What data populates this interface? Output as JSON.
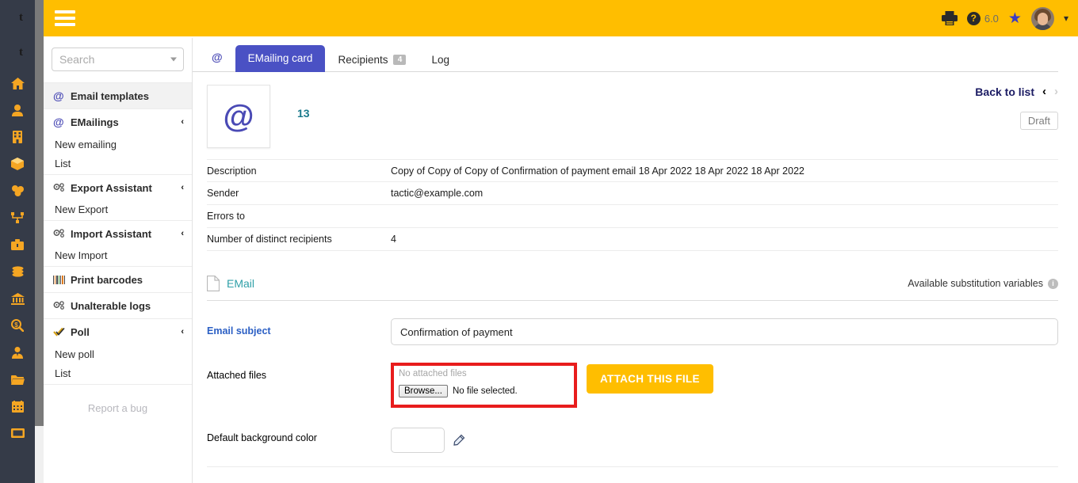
{
  "topbar": {
    "menu_icon": "hamburger-icon",
    "print_icon": "printer-icon",
    "help_icon": "help-question-icon",
    "version": "6.0",
    "star_icon": "star-icon",
    "avatar_icon": "user-avatar",
    "caret": "⌄"
  },
  "sidebar": {
    "search": {
      "value": "",
      "placeholder": "Search"
    },
    "groups": [
      {
        "icon": "at-icon",
        "label": "Email templates",
        "active": true,
        "collapsible": false,
        "chevron": "",
        "items": []
      },
      {
        "icon": "at-icon",
        "label": "EMailings",
        "active": false,
        "collapsible": true,
        "chevron": "‹",
        "items": [
          "New emailing",
          "List"
        ]
      },
      {
        "icon": "gear-icon",
        "label": "Export Assistant",
        "active": false,
        "collapsible": true,
        "chevron": "‹",
        "items": [
          "New Export"
        ]
      },
      {
        "icon": "gear-icon",
        "label": "Import Assistant",
        "active": false,
        "collapsible": true,
        "chevron": "‹",
        "items": [
          "New Import"
        ]
      },
      {
        "icon": "barcode-icon",
        "label": "Print barcodes",
        "active": false,
        "collapsible": false,
        "chevron": "",
        "items": []
      },
      {
        "icon": "gear-icon",
        "label": "Unalterable logs",
        "active": false,
        "collapsible": false,
        "chevron": "",
        "items": []
      },
      {
        "icon": "check-icon",
        "label": "Poll",
        "active": false,
        "collapsible": true,
        "chevron": "‹",
        "items": [
          "New poll",
          "List"
        ]
      }
    ],
    "report_bug": "Report a bug"
  },
  "rail": {
    "icons": [
      "home-icon",
      "user-icon",
      "building-icon",
      "box-icon",
      "coins-stack-icon",
      "share-nodes-icon",
      "briefcase-icon",
      "money-icon",
      "bank-icon",
      "search-money-icon",
      "user-tie-icon",
      "folder-open-icon",
      "calendar-icon",
      "ticket-icon"
    ]
  },
  "tabs": {
    "at_icon": "at-icon",
    "items": [
      {
        "label": "EMailing card",
        "active": true,
        "badge": ""
      },
      {
        "label": "Recipients",
        "active": false,
        "badge": "4"
      },
      {
        "label": "Log",
        "active": false,
        "badge": ""
      }
    ]
  },
  "card": {
    "thumb_icon": "at-icon",
    "record_id": "13",
    "back_to_list": "Back to list",
    "prev_icon": "‹",
    "next_icon": "›",
    "status": "Draft"
  },
  "details": [
    {
      "label": "Description",
      "value": "Copy of Copy of Copy of Confirmation of payment email 18 Apr 2022 18 Apr 2022 18 Apr 2022"
    },
    {
      "label": "Sender",
      "value": "tactic@example.com"
    },
    {
      "label": "Errors to",
      "value": ""
    },
    {
      "label": "Number of distinct recipients",
      "value": "4"
    }
  ],
  "email_section": {
    "doc_icon": "document-icon",
    "title": "EMail",
    "substitution_link": "Available substitution variables",
    "info_icon": "info-icon"
  },
  "form": {
    "subject_label": "Email subject",
    "subject_value": "Confirmation of payment",
    "attached_label": "Attached files",
    "no_attached_files": "No attached files",
    "browse_button": "Browse...",
    "no_file_selected": "No file selected.",
    "attach_button": "ATTACH THIS FILE",
    "bgcolor_label": "Default background color",
    "bgcolor_value": "#ffffff",
    "picker_icon": "eyedropper-icon"
  },
  "colors": {
    "brand_yellow": "#ffbe00",
    "tab_blue": "#4a51c4",
    "highlight_red": "#e81c1c",
    "rail_dark": "#353b48",
    "teal": "#1b7a8c"
  }
}
